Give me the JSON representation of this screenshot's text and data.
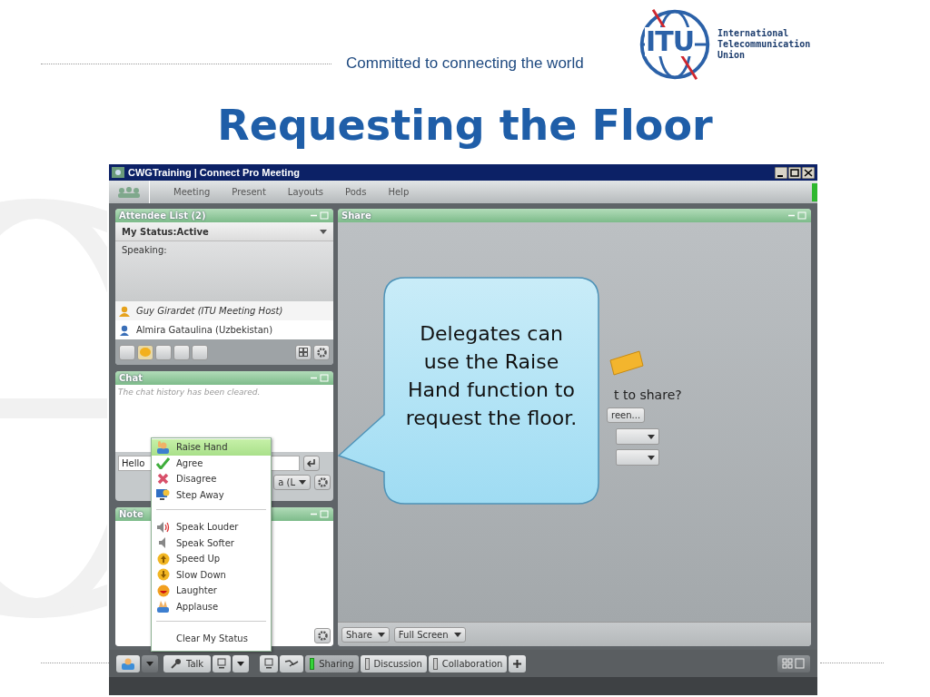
{
  "slide": {
    "tagline": "Committed to connecting the world",
    "logo_mark": "ITU",
    "logo_lines": [
      "International",
      "Telecommunication",
      "Union"
    ],
    "title": "Requesting the Floor"
  },
  "window": {
    "title": "CWGTraining | Connect Pro Meeting"
  },
  "menu_bar": [
    "Meeting",
    "Present",
    "Layouts",
    "Pods",
    "Help"
  ],
  "attendee_pod": {
    "title": "Attendee List (2)",
    "status": "My Status:Active",
    "speaking_label": "Speaking:",
    "attendees": [
      {
        "name": "Guy Girardet (ITU Meeting Host)",
        "kind": "host"
      },
      {
        "name": "Almira Gataulina (Uzbekistan)",
        "kind": "participant"
      }
    ]
  },
  "chat_pod": {
    "title": "Chat",
    "history_note": "The chat history has been cleared.",
    "message_value": "Hello",
    "recipient": "a (L"
  },
  "note_pod": {
    "title": "Note"
  },
  "share_pod": {
    "title": "Share",
    "prompt": "t to share?",
    "screen_button": "reen...",
    "share_button": "Share",
    "fullscreen_button": "Full Screen"
  },
  "status_menu": {
    "groups": [
      [
        {
          "label": "Raise Hand",
          "selected": true
        },
        {
          "label": "Agree",
          "selected": false
        },
        {
          "label": "Disagree",
          "selected": false
        },
        {
          "label": "Step Away",
          "selected": false
        }
      ],
      [
        {
          "label": "Speak Louder",
          "selected": false
        },
        {
          "label": "Speak Softer",
          "selected": false
        },
        {
          "label": "Speed Up",
          "selected": false
        },
        {
          "label": "Slow Down",
          "selected": false
        },
        {
          "label": "Laughter",
          "selected": false
        },
        {
          "label": "Applause",
          "selected": false
        }
      ],
      [
        {
          "label": "Clear My Status",
          "selected": false
        }
      ]
    ]
  },
  "bottom_bar": {
    "talk": "Talk",
    "layouts": [
      {
        "label": "Sharing",
        "selected": true
      },
      {
        "label": "Discussion",
        "selected": false
      },
      {
        "label": "Collaboration",
        "selected": false
      }
    ]
  },
  "callout": {
    "text": "Delegates can use the Raise Hand function to request the floor."
  }
}
